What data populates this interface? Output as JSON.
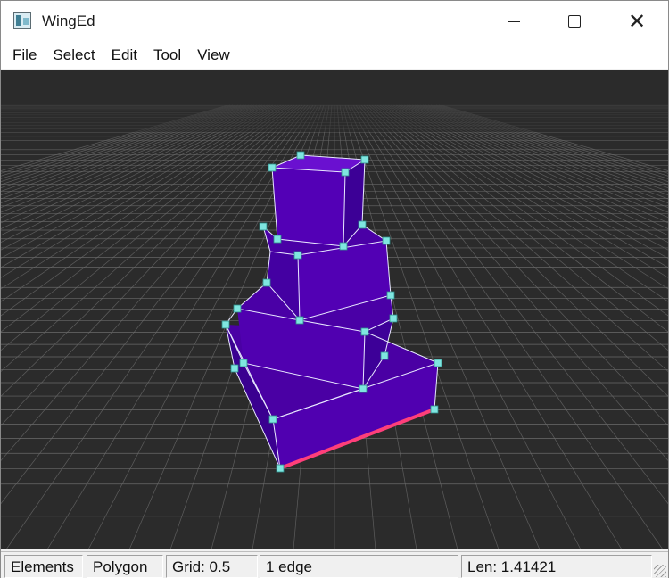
{
  "window": {
    "title": "WingEd",
    "icon": "app-icon",
    "controls": {
      "minimize": "minimize-icon",
      "maximize": "maximize-icon",
      "close": "close-icon"
    }
  },
  "menubar": {
    "items": [
      "File",
      "Select",
      "Edit",
      "Tool",
      "View"
    ]
  },
  "viewport": {
    "background": "#2b2b2b",
    "grid_color": "#6a6a6a",
    "mesh_face_color": "#5000b0",
    "mesh_edge_color": "#e8e8ff",
    "vertex_color": "#7fe6e0",
    "selected_edge_color": "#ff3f7a"
  },
  "statusbar": {
    "mode": "Elements",
    "element_type": "Polygon",
    "grid": "Grid:  0.5",
    "selection": "1 edge",
    "length": "Len:  1.41421"
  }
}
